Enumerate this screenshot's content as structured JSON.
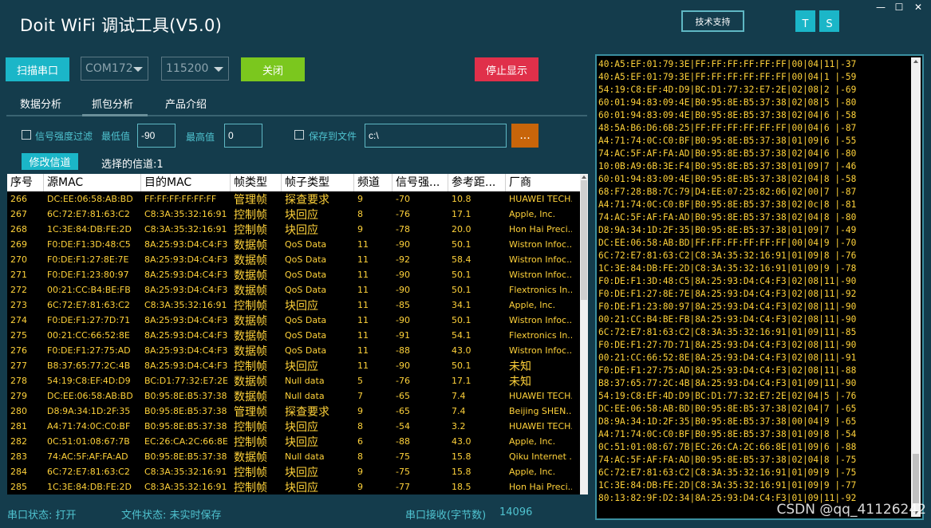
{
  "app": {
    "title": "Doit WiFi 调试工具(V5.0)",
    "support_label": "技术支持",
    "t_label": "T",
    "s_label": "S",
    "minimize": "—",
    "maximize": "☐",
    "close": "✕"
  },
  "toolbar": {
    "scan_label": "扫描串口",
    "port_value": "COM172",
    "baud_value": "115200",
    "close_label": "关闭",
    "stop_label": "停止显示"
  },
  "tabs": [
    {
      "label": "数据分析"
    },
    {
      "label": "抓包分析"
    },
    {
      "label": "产品介绍"
    }
  ],
  "filters": {
    "signal_filter_label": "信号强度过滤",
    "min_label": "最低值",
    "min_value": "-90",
    "max_label": "最高值",
    "max_value": "0",
    "save_label": "保存到文件",
    "path_value": "c:\\",
    "browse_label": "..."
  },
  "channel": {
    "modify_label": "修改信道",
    "selected_label": "选择的信道:1"
  },
  "table": {
    "headers": [
      "序号",
      "源MAC",
      "目的MAC",
      "帧类型",
      "帧子类型",
      "频道",
      "信号强...",
      "参考距...",
      "厂商"
    ],
    "rows": [
      [
        "266",
        "DC:EE:06:58:AB:BD",
        "FF:FF:FF:FF:FF:FF",
        "管理帧",
        "探查要求",
        "9",
        "-70",
        "10.8",
        "HUAWEI TECH..."
      ],
      [
        "267",
        "6C:72:E7:81:63:C2",
        "C8:3A:35:32:16:91",
        "控制帧",
        "块回应",
        "8",
        "-76",
        "17.1",
        "Apple, Inc."
      ],
      [
        "268",
        "1C:3E:84:DB:FE:2D",
        "C8:3A:35:32:16:91",
        "控制帧",
        "块回应",
        "9",
        "-78",
        "20.0",
        "Hon Hai Preci..."
      ],
      [
        "269",
        "F0:DE:F1:3D:48:C5",
        "8A:25:93:D4:C4:F3",
        "数据帧",
        "QoS Data",
        "11",
        "-90",
        "50.1",
        "Wistron Infoc..."
      ],
      [
        "270",
        "F0:DE:F1:27:8E:7E",
        "8A:25:93:D4:C4:F3",
        "数据帧",
        "QoS Data",
        "11",
        "-92",
        "58.4",
        "Wistron Infoc..."
      ],
      [
        "271",
        "F0:DE:F1:23:80:97",
        "8A:25:93:D4:C4:F3",
        "数据帧",
        "QoS Data",
        "11",
        "-90",
        "50.1",
        "Wistron Infoc..."
      ],
      [
        "272",
        "00:21:CC:B4:BE:FB",
        "8A:25:93:D4:C4:F3",
        "数据帧",
        "QoS Data",
        "11",
        "-90",
        "50.1",
        "Flextronics In..."
      ],
      [
        "273",
        "6C:72:E7:81:63:C2",
        "C8:3A:35:32:16:91",
        "控制帧",
        "块回应",
        "11",
        "-85",
        "34.1",
        "Apple, Inc."
      ],
      [
        "274",
        "F0:DE:F1:27:7D:71",
        "8A:25:93:D4:C4:F3",
        "数据帧",
        "QoS Data",
        "11",
        "-90",
        "50.1",
        "Wistron Infoc..."
      ],
      [
        "275",
        "00:21:CC:66:52:8E",
        "8A:25:93:D4:C4:F3",
        "数据帧",
        "QoS Data",
        "11",
        "-91",
        "54.1",
        "Flextronics In..."
      ],
      [
        "276",
        "F0:DE:F1:27:75:AD",
        "8A:25:93:D4:C4:F3",
        "数据帧",
        "QoS Data",
        "11",
        "-88",
        "43.0",
        "Wistron Infoc..."
      ],
      [
        "277",
        "B8:37:65:77:2C:4B",
        "8A:25:93:D4:C4:F3",
        "控制帧",
        "块回应",
        "11",
        "-90",
        "50.1",
        "未知"
      ],
      [
        "278",
        "54:19:C8:EF:4D:D9",
        "BC:D1:77:32:E7:2E",
        "数据帧",
        "Null data",
        "5",
        "-76",
        "17.1",
        "未知"
      ],
      [
        "279",
        "DC:EE:06:58:AB:BD",
        "B0:95:8E:B5:37:38",
        "数据帧",
        "Null data",
        "7",
        "-65",
        "7.4",
        "HUAWEI TECH..."
      ],
      [
        "280",
        "D8:9A:34:1D:2F:35",
        "B0:95:8E:B5:37:38",
        "管理帧",
        "探查要求",
        "9",
        "-65",
        "7.4",
        "Beijing SHEN..."
      ],
      [
        "281",
        "A4:71:74:0C:C0:BF",
        "B0:95:8E:B5:37:38",
        "控制帧",
        "块回应",
        "8",
        "-54",
        "3.2",
        "HUAWEI TECH..."
      ],
      [
        "282",
        "0C:51:01:08:67:7B",
        "EC:26:CA:2C:66:8E",
        "控制帧",
        "块回应",
        "6",
        "-88",
        "43.0",
        "Apple, Inc."
      ],
      [
        "283",
        "74:AC:5F:AF:FA:AD",
        "B0:95:8E:B5:37:38",
        "数据帧",
        "Null data",
        "8",
        "-75",
        "15.8",
        "Qiku Internet ..."
      ],
      [
        "284",
        "6C:72:E7:81:63:C2",
        "C8:3A:35:32:16:91",
        "控制帧",
        "块回应",
        "9",
        "-75",
        "15.8",
        "Apple, Inc."
      ],
      [
        "285",
        "1C:3E:84:DB:FE:2D",
        "C8:3A:35:32:16:91",
        "控制帧",
        "块回应",
        "9",
        "-77",
        "18.5",
        "Hon Hai Preci..."
      ]
    ]
  },
  "log": [
    "40:A5:EF:01:79:3E|FF:FF:FF:FF:FF:FF|00|04|11|-37",
    "40:A5:EF:01:79:3E|FF:FF:FF:FF:FF:FF|00|04|1 |-59",
    "54:19:C8:EF:4D:D9|BC:D1:77:32:E7:2E|02|08|2 |-69",
    "60:01:94:83:09:4E|B0:95:8E:B5:37:38|02|08|5 |-80",
    "60:01:94:83:09:4E|B0:95:8E:B5:37:38|02|04|6 |-58",
    "48:5A:B6:D6:6B:25|FF:FF:FF:FF:FF:FF|00|04|6 |-87",
    "A4:71:74:0C:C0:BF|B0:95:8E:B5:37:38|01|09|6 |-55",
    "74:AC:5F:AF:FA:AD|B0:95:8E:B5:37:38|02|04|6 |-80",
    "10:0B:A9:6B:3E:F4|B0:95:8E:B5:37:38|01|09|7 |-46",
    "60:01:94:83:09:4E|B0:95:8E:B5:37:38|02|04|8 |-58",
    "68:F7:28:B8:7C:79|D4:EE:07:25:82:06|02|00|7 |-87",
    "A4:71:74:0C:C0:BF|B0:95:8E:B5:37:38|02|0c|8 |-81",
    "74:AC:5F:AF:FA:AD|B0:95:8E:B5:37:38|02|04|8 |-80",
    "D8:9A:34:1D:2F:35|B0:95:8E:B5:37:38|01|09|7 |-49",
    "DC:EE:06:58:AB:BD|FF:FF:FF:FF:FF:FF|00|04|9 |-70",
    "6C:72:E7:81:63:C2|C8:3A:35:32:16:91|01|09|8 |-76",
    "1C:3E:84:DB:FE:2D|C8:3A:35:32:16:91|01|09|9 |-78",
    "F0:DE:F1:3D:48:C5|8A:25:93:D4:C4:F3|02|08|11|-90",
    "F0:DE:F1:27:8E:7E|8A:25:93:D4:C4:F3|02|08|11|-92",
    "F0:DE:F1:23:80:97|8A:25:93:D4:C4:F3|02|08|11|-90",
    "00:21:CC:B4:BE:FB|8A:25:93:D4:C4:F3|02|08|11|-90",
    "6C:72:E7:81:63:C2|C8:3A:35:32:16:91|01|09|11|-85",
    "F0:DE:F1:27:7D:71|8A:25:93:D4:C4:F3|02|08|11|-90",
    "00:21:CC:66:52:8E|8A:25:93:D4:C4:F3|02|08|11|-91",
    "F0:DE:F1:27:75:AD|8A:25:93:D4:C4:F3|02|08|11|-88",
    "B8:37:65:77:2C:4B|8A:25:93:D4:C4:F3|01|09|11|-90",
    "54:19:C8:EF:4D:D9|BC:D1:77:32:E7:2E|02|04|5 |-76",
    "DC:EE:06:58:AB:BD|B0:95:8E:B5:37:38|02|04|7 |-65",
    "D8:9A:34:1D:2F:35|B0:95:8E:B5:37:38|00|04|9 |-65",
    "A4:71:74:0C:C0:BF|B0:95:8E:B5:37:38|01|09|8 |-54",
    "0C:51:01:08:67:7B|EC:26:CA:2C:66:8E|01|09|6 |-88",
    "74:AC:5F:AF:FA:AD|B0:95:8E:B5:37:38|02|04|8 |-75",
    "6C:72:E7:81:63:C2|C8:3A:35:32:16:91|01|09|9 |-75",
    "1C:3E:84:DB:FE:2D|C8:3A:35:32:16:91|01|09|9 |-77",
    "80:13:82:9F:D2:34|8A:25:93:D4:C4:F3|01|09|11|-92"
  ],
  "status": {
    "port_status": "串口状态: 打开",
    "file_status": "文件状态: 未实时保存",
    "recv_label": "串口接收(字节数)",
    "recv_value": "14096"
  },
  "watermark": "CSDN @qq_41126242"
}
